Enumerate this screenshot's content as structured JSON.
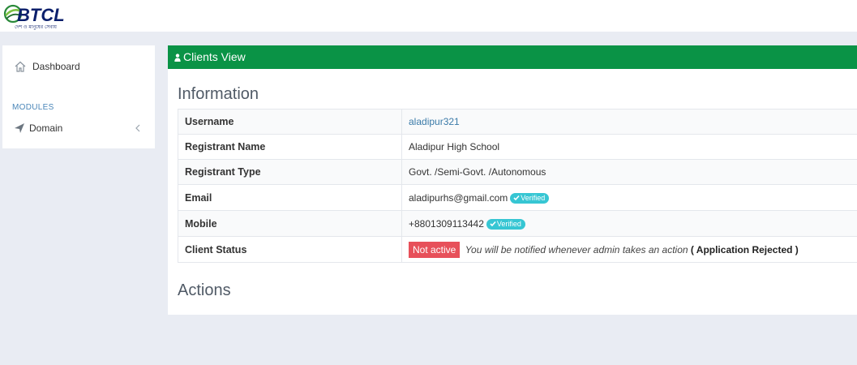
{
  "brand": {
    "logo_text": "BTCL",
    "logo_tagline": "দেশ ও মানুষের সেবায়"
  },
  "sidebar": {
    "dashboard_label": "Dashboard",
    "modules_label": "MODULES",
    "domain_label": "Domain"
  },
  "page": {
    "header_title": "Clients View",
    "information_title": "Information",
    "actions_title": "Actions"
  },
  "info": {
    "username_label": "Username",
    "username_value": "aladipur321",
    "registrant_name_label": "Registrant Name",
    "registrant_name_value": "Aladipur High School",
    "registrant_type_label": "Registrant Type",
    "registrant_type_value": "Govt. /Semi-Govt. /Autonomous",
    "email_label": "Email",
    "email_value": "aladipurhs@gmail.com",
    "email_badge": "Verified",
    "mobile_label": "Mobile",
    "mobile_value": "+8801309113442",
    "mobile_badge": "Verified",
    "status_label": "Client Status",
    "status_badge": "Not active",
    "status_note": "You will be notified whenever admin takes an action",
    "status_reason": "( Application Rejected )"
  },
  "colors": {
    "header_green": "#0a9346",
    "verified": "#36c6d3",
    "not_active": "#e7505a",
    "link": "#3a7aa8"
  },
  "icons": [
    "home-icon",
    "paper-plane-icon",
    "chevron-left-icon",
    "user-icon",
    "check-icon"
  ]
}
